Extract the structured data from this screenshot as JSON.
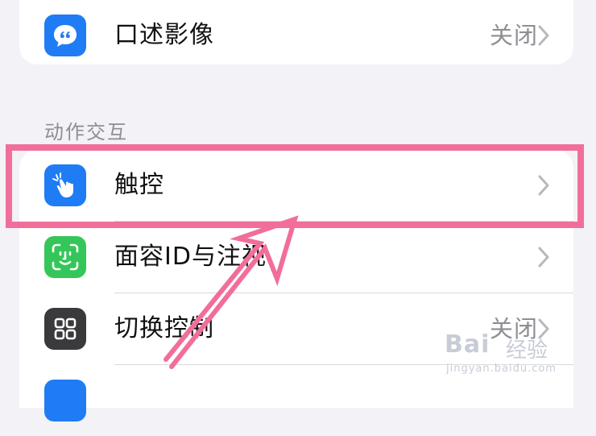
{
  "rows_top": [
    {
      "label": "口述影像",
      "value": "关闭",
      "icon": "speech-bubble-icon",
      "color": "#1f7cf5"
    }
  ],
  "section_header": "动作交互",
  "rows_main": [
    {
      "label": "触控",
      "value": "",
      "icon": "hand-touch-icon",
      "color": "#1f7cf5"
    },
    {
      "label": "面容ID与注视",
      "value": "",
      "icon": "face-id-icon",
      "color": "#35c659"
    },
    {
      "label": "切换控制",
      "value": "关闭",
      "icon": "switch-control-icon",
      "color": "#3a3a3c"
    },
    {
      "label": "",
      "value": "",
      "icon": "partial-app-icon",
      "color": "#1f7cf5"
    }
  ],
  "annotation": {
    "highlight_color": "#f26e9a"
  },
  "watermark": {
    "brand": "Bai",
    "brand_cn": "经验",
    "url": "jingyan.baidu.com"
  }
}
